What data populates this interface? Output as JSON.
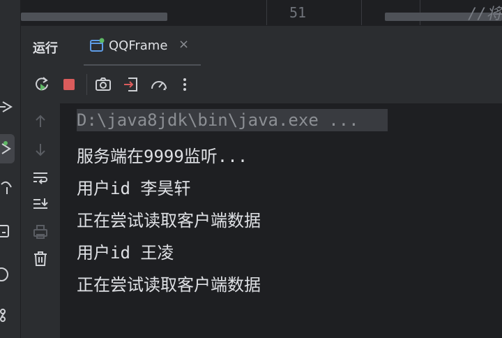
{
  "editor": {
    "line_number": "51",
    "comment_fragment": "//将"
  },
  "tool_window": {
    "title": "运行",
    "tab": {
      "label": "QQFrame",
      "close": "×"
    }
  },
  "toolbar": {
    "buttons": [
      "rerun-icon",
      "stop-icon",
      "camera-icon",
      "restore-layout-icon",
      "profiler-icon",
      "more-icon"
    ]
  },
  "console": {
    "lines": [
      "D:\\java8jdk\\bin\\java.exe ...",
      "服务端在9999监听...",
      "用户id 李昊轩",
      "正在尝试读取客户端数据",
      "用户id 王凌",
      "正在尝试读取客户端数据"
    ]
  },
  "colors": {
    "background": "#1e1f22",
    "panel": "#2b2d30",
    "text": "#dfe1e5",
    "stop_red": "#db5c5c",
    "run_green": "#5fb865"
  }
}
